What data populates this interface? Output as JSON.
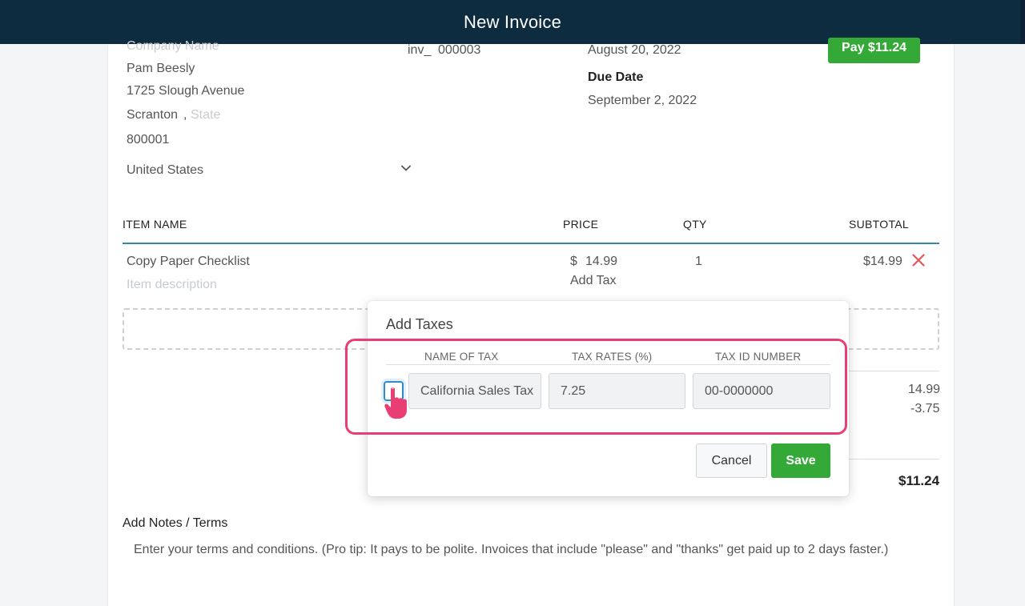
{
  "header": {
    "title": "New Invoice"
  },
  "customer": {
    "company_placeholder": "Company Name",
    "name": "Pam Beesly",
    "address": "1725 Slough Avenue",
    "city": "Scranton",
    "city_sep": ",",
    "state_placeholder": "State",
    "zip": "800001",
    "country": "United States"
  },
  "invoice": {
    "number_prefix": "inv_",
    "number": "000003",
    "issue_date": "August 20, 2022",
    "due_label": "Due Date",
    "due_date": "September 2, 2022",
    "pay_button": "Pay $11.24"
  },
  "items_table": {
    "headers": {
      "name": "ITEM NAME",
      "price": "PRICE",
      "qty": "QTY",
      "subtotal": "SUBTOTAL"
    },
    "rows": [
      {
        "name": "Copy Paper Checklist",
        "description_placeholder": "Item description",
        "currency": "$",
        "price": "14.99",
        "add_tax": "Add Tax",
        "qty": "1",
        "subtotal": "$14.99"
      }
    ]
  },
  "summary": {
    "subtotal": "14.99",
    "discount": "-3.75",
    "total": "$11.24"
  },
  "notes": {
    "title": "Add Notes / Terms",
    "placeholder": "Enter your terms and conditions. (Pro tip: It pays to be polite. Invoices that include \"please\" and \"thanks\" get paid up to 2 days faster.)"
  },
  "tax_modal": {
    "title": "Add Taxes",
    "columns": {
      "name": "NAME OF TAX",
      "rate": "TAX RATES (%)",
      "id": "TAX ID NUMBER"
    },
    "row": {
      "name": "California Sales Tax",
      "rate": "7.25",
      "id": "00-0000000",
      "checked": false
    },
    "cancel": "Cancel",
    "save": "Save"
  },
  "colors": {
    "topbar": "#0e2c40",
    "accent_green": "#34a937",
    "table_rule": "#2e8bb0",
    "highlight": "#e83e73",
    "remove": "#e8555a"
  },
  "icons": {
    "country_dropdown": "chevron-down-icon",
    "remove_item": "close-icon",
    "pointer": "hand-pointer-icon"
  }
}
